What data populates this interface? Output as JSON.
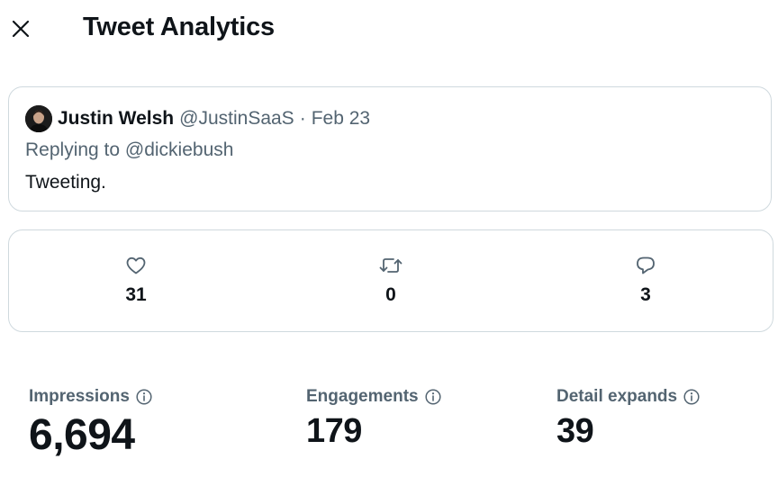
{
  "header": {
    "title": "Tweet Analytics",
    "close_icon": "close-icon"
  },
  "tweet": {
    "author_name": "Justin Welsh",
    "author_handle": "@JustinSaaS",
    "separator": "·",
    "date": "Feb 23",
    "reply_line": "Replying to @dickiebush",
    "text": "Tweeting."
  },
  "engagement": {
    "likes": {
      "icon": "heart-icon",
      "count": "31"
    },
    "retweets": {
      "icon": "retweet-icon",
      "count": "0"
    },
    "replies": {
      "icon": "reply-icon",
      "count": "3"
    }
  },
  "metrics": {
    "impressions": {
      "label": "Impressions",
      "value": "6,694"
    },
    "engagements": {
      "label": "Engagements",
      "value": "179"
    },
    "detail_expands": {
      "label": "Detail expands",
      "value": "39"
    }
  },
  "colors": {
    "text_primary": "#0f1419",
    "text_secondary": "#536471",
    "border": "#cfd9de"
  }
}
